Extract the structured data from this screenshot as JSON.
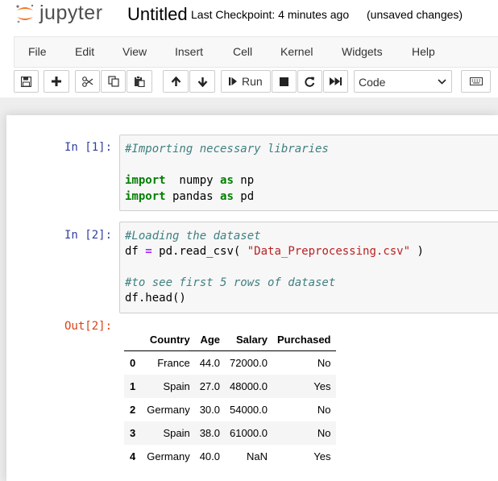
{
  "header": {
    "logo_text": "jupyter",
    "notebook_title": "Untitled",
    "checkpoint": "Last Checkpoint: 4 minutes ago",
    "save_status": "(unsaved changes)",
    "logo_color": "#f37626"
  },
  "menu": [
    "File",
    "Edit",
    "View",
    "Insert",
    "Cell",
    "Kernel",
    "Widgets",
    "Help"
  ],
  "toolbar": {
    "run_label": "Run",
    "cell_type": "Code",
    "icons": [
      "save-icon",
      "plus-icon",
      "cut-icon",
      "copy-icon",
      "paste-icon",
      "arrow-up-icon",
      "arrow-down-icon",
      "step-forward-icon",
      "stop-icon",
      "restart-icon",
      "fast-forward-icon",
      "keyboard-icon"
    ]
  },
  "cells": [
    {
      "prompt": "In [1]:",
      "lines": [
        [
          {
            "t": "#Importing necessary libraries",
            "c": "cm"
          }
        ],
        [],
        [
          {
            "t": "import",
            "c": "kw"
          },
          {
            "t": "  numpy ",
            "c": ""
          },
          {
            "t": "as",
            "c": "kw"
          },
          {
            "t": " np",
            "c": ""
          }
        ],
        [
          {
            "t": "import",
            "c": "kw"
          },
          {
            "t": " pandas ",
            "c": ""
          },
          {
            "t": "as",
            "c": "kw"
          },
          {
            "t": " pd",
            "c": ""
          }
        ]
      ]
    },
    {
      "prompt": "In [2]:",
      "lines": [
        [
          {
            "t": "#Loading the dataset",
            "c": "cm"
          }
        ],
        [
          {
            "t": "df ",
            "c": ""
          },
          {
            "t": "=",
            "c": "op"
          },
          {
            "t": " pd.read_csv( ",
            "c": ""
          },
          {
            "t": "\"Data_Preprocessing.csv\"",
            "c": "str"
          },
          {
            "t": " )",
            "c": ""
          }
        ],
        [],
        [
          {
            "t": "#to see first 5 rows of dataset",
            "c": "cm"
          }
        ],
        [
          {
            "t": "df.head()",
            "c": ""
          }
        ]
      ]
    }
  ],
  "output": {
    "prompt": "Out[2]:",
    "columns": [
      "",
      "Country",
      "Age",
      "Salary",
      "Purchased"
    ],
    "rows": [
      [
        "0",
        "France",
        "44.0",
        "72000.0",
        "No"
      ],
      [
        "1",
        "Spain",
        "27.0",
        "48000.0",
        "Yes"
      ],
      [
        "2",
        "Germany",
        "30.0",
        "54000.0",
        "No"
      ],
      [
        "3",
        "Spain",
        "38.0",
        "61000.0",
        "No"
      ],
      [
        "4",
        "Germany",
        "40.0",
        "NaN",
        "Yes"
      ]
    ]
  }
}
